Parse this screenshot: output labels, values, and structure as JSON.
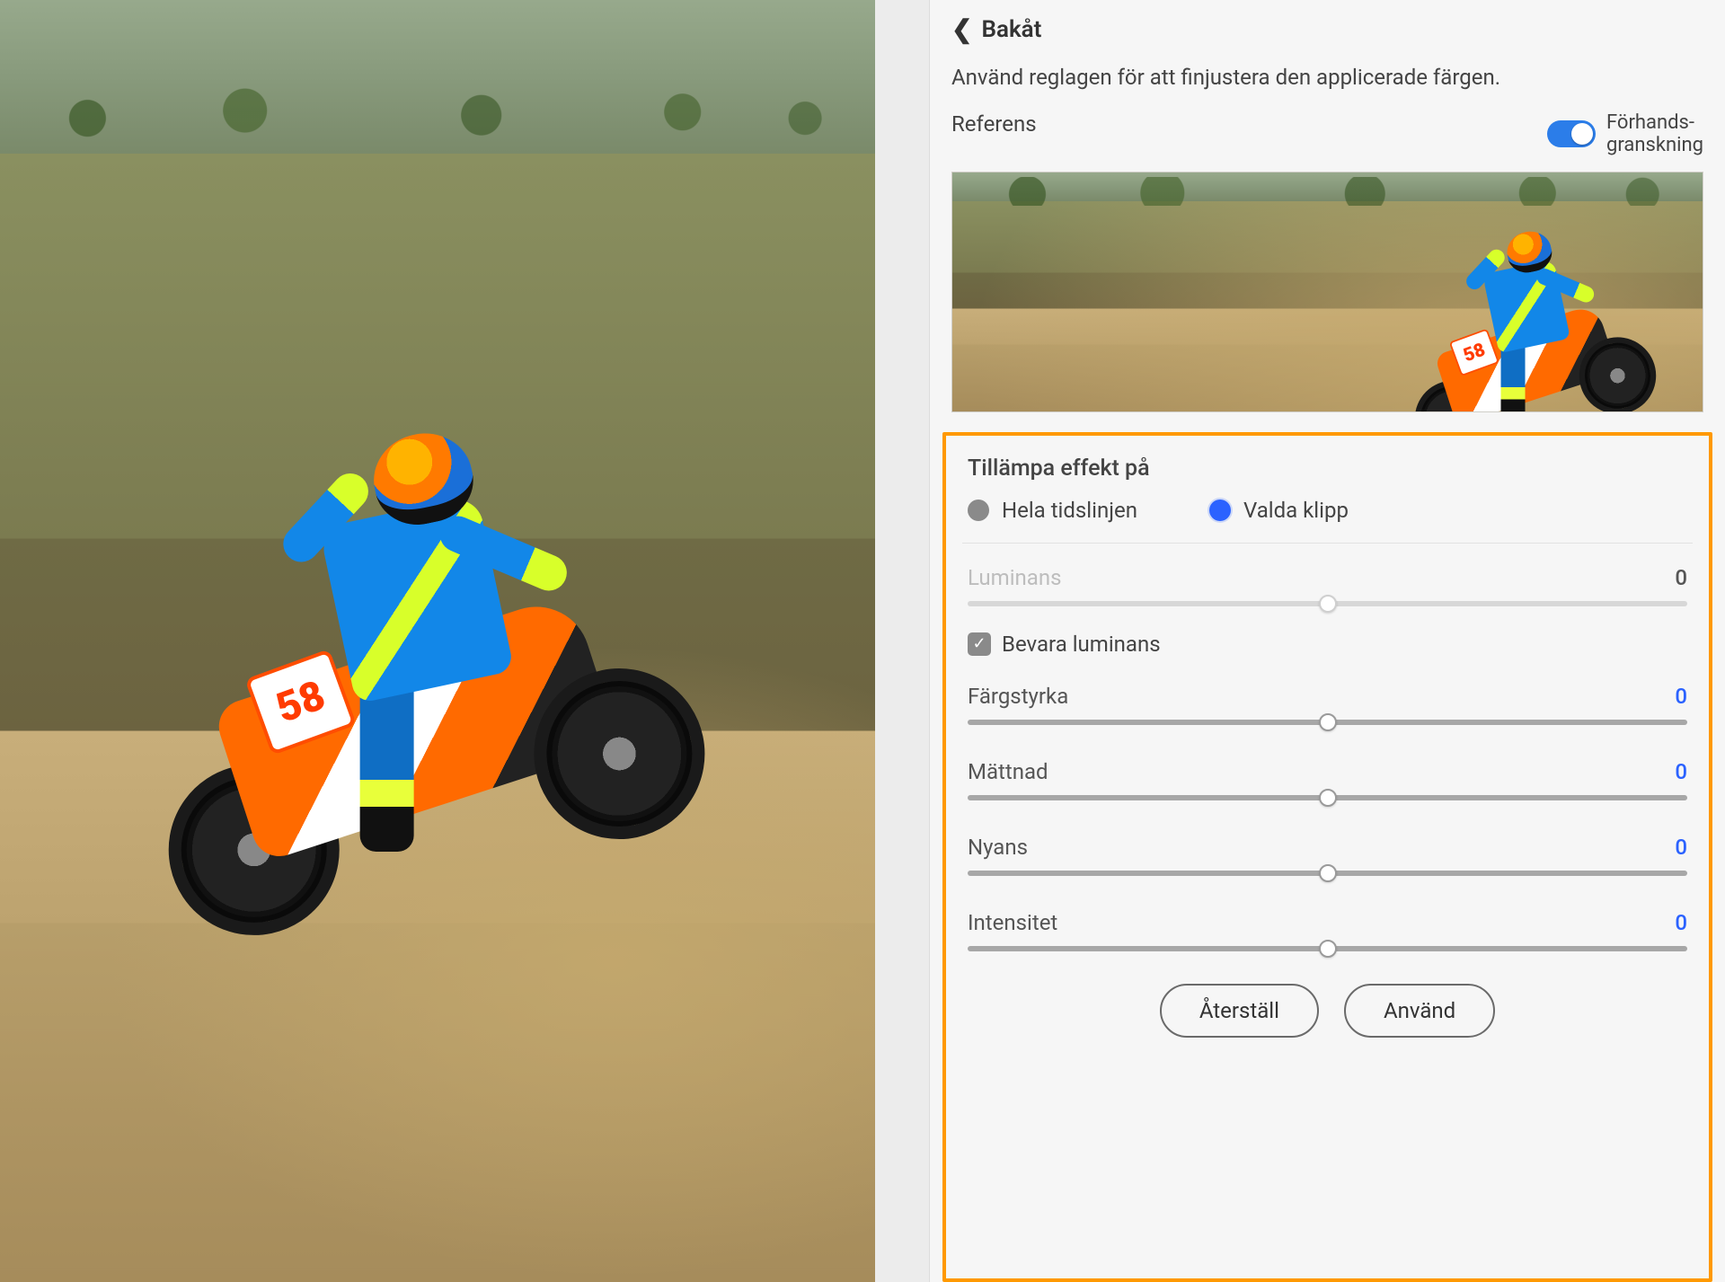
{
  "panel": {
    "back_label": "Bakåt",
    "instruction": "Använd reglagen för att finjustera den applicerade färgen.",
    "reference_label": "Referens",
    "preview_toggle": {
      "label": "Förhands-\ngranskning",
      "on": true
    },
    "apply_section": {
      "title": "Tillämpa effekt på",
      "options": {
        "whole_timeline": "Hela tidslinjen",
        "selected_clips": "Valda klipp"
      },
      "selected": "selected_clips"
    },
    "sliders": {
      "luminance": {
        "label": "Luminans",
        "value": 0,
        "enabled": false
      },
      "preserve": {
        "label": "Bevara luminans",
        "checked": true
      },
      "color_strength": {
        "label": "Färgstyrka",
        "value": 0,
        "enabled": true
      },
      "saturation": {
        "label": "Mättnad",
        "value": 0,
        "enabled": true
      },
      "hue": {
        "label": "Nyans",
        "value": 0,
        "enabled": true
      },
      "intensity": {
        "label": "Intensitet",
        "value": 0,
        "enabled": true
      }
    },
    "buttons": {
      "reset": "Återställ",
      "apply": "Använd"
    }
  },
  "preview": {
    "plate_number": "58"
  },
  "colors": {
    "accent": "#2b62ff",
    "toggle": "#2b7de9",
    "highlight_border": "#ff9900"
  }
}
